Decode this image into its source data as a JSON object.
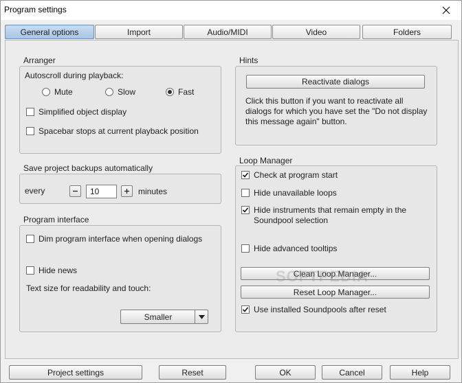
{
  "window": {
    "title": "Program settings"
  },
  "tabs": [
    {
      "label": "General options",
      "active": true
    },
    {
      "label": "Import",
      "active": false
    },
    {
      "label": "Audio/MIDI",
      "active": false
    },
    {
      "label": "Video",
      "active": false
    },
    {
      "label": "Folders",
      "active": false
    }
  ],
  "arranger": {
    "title": "Arranger",
    "autoscroll_label": "Autoscroll during playback:",
    "radio_options": [
      {
        "label": "Mute",
        "checked": false
      },
      {
        "label": "Slow",
        "checked": false
      },
      {
        "label": "Fast",
        "checked": true
      }
    ],
    "checkboxes": [
      {
        "label": "Simplified object display",
        "checked": false
      },
      {
        "label": "Spacebar stops at current playback position",
        "checked": false
      }
    ]
  },
  "backups": {
    "title": "Save project backups automatically",
    "every_label": "every",
    "value": "10",
    "unit": "minutes"
  },
  "program_interface": {
    "title": "Program interface",
    "checkboxes": [
      {
        "label": "Dim program interface when opening dialogs",
        "checked": false
      },
      {
        "label": "Hide news",
        "checked": false
      }
    ],
    "text_size_label": "Text size for readability and touch:",
    "text_size_value": "Smaller"
  },
  "hints": {
    "title": "Hints",
    "reactivate_button": "Reactivate dialogs",
    "description": "Click this button if you want to reactivate all dialogs for which you have set the \"Do not display this message again\" button."
  },
  "loop_manager": {
    "title": "Loop Manager",
    "checkboxes": [
      {
        "label": "Check at program start",
        "checked": true
      },
      {
        "label": "Hide unavailable loops",
        "checked": false
      },
      {
        "label": "Hide instruments that remain empty in the Soundpool selection",
        "checked": true
      },
      {
        "label": "Hide advanced tooltips",
        "checked": false
      }
    ],
    "clean_button": "Clean Loop Manager...",
    "reset_button": "Reset Loop Manager...",
    "use_installed": {
      "label": "Use installed Soundpools after reset",
      "checked": true
    }
  },
  "footer": {
    "project_settings": "Project settings",
    "reset": "Reset",
    "ok": "OK",
    "cancel": "Cancel",
    "help": "Help"
  },
  "watermark": "SOFTPEDIA"
}
